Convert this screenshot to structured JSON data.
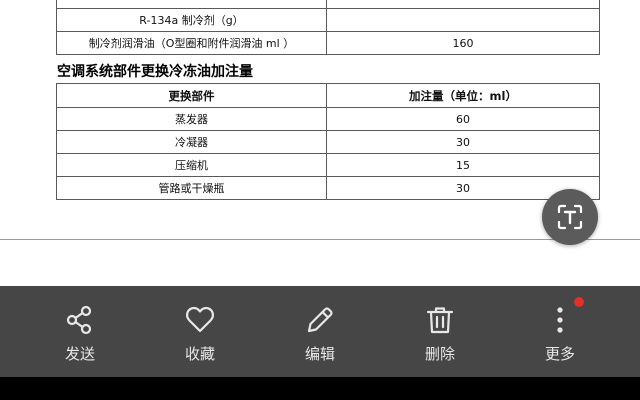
{
  "spec_table": {
    "rows": [
      {
        "label": "",
        "value": ""
      },
      {
        "label": "R-134a 制冷剂（g）",
        "value": ""
      },
      {
        "label": "制冷剂润滑油（O型圈和附件润滑油 ml ）",
        "value": "160"
      }
    ]
  },
  "oil_section": {
    "title": "空调系统部件更换冷冻油加注量",
    "headers": [
      "更换部件",
      "加注量（单位：ml）"
    ],
    "rows": [
      {
        "part": "蒸发器",
        "amount": "60"
      },
      {
        "part": "冷凝器",
        "amount": "30"
      },
      {
        "part": "压缩机",
        "amount": "15"
      },
      {
        "part": "管路或干燥瓶",
        "amount": "30"
      }
    ]
  },
  "action_bar": {
    "items": [
      {
        "label": "发送",
        "icon": "share-icon"
      },
      {
        "label": "收藏",
        "icon": "heart-icon"
      },
      {
        "label": "编辑",
        "icon": "pencil-icon"
      },
      {
        "label": "删除",
        "icon": "trash-icon"
      },
      {
        "label": "更多",
        "icon": "more-vertical-icon"
      }
    ]
  },
  "colors": {
    "action_bar_bg": "#464646",
    "badge": "#e0302a",
    "fab_bg": "#5b5b5b"
  }
}
